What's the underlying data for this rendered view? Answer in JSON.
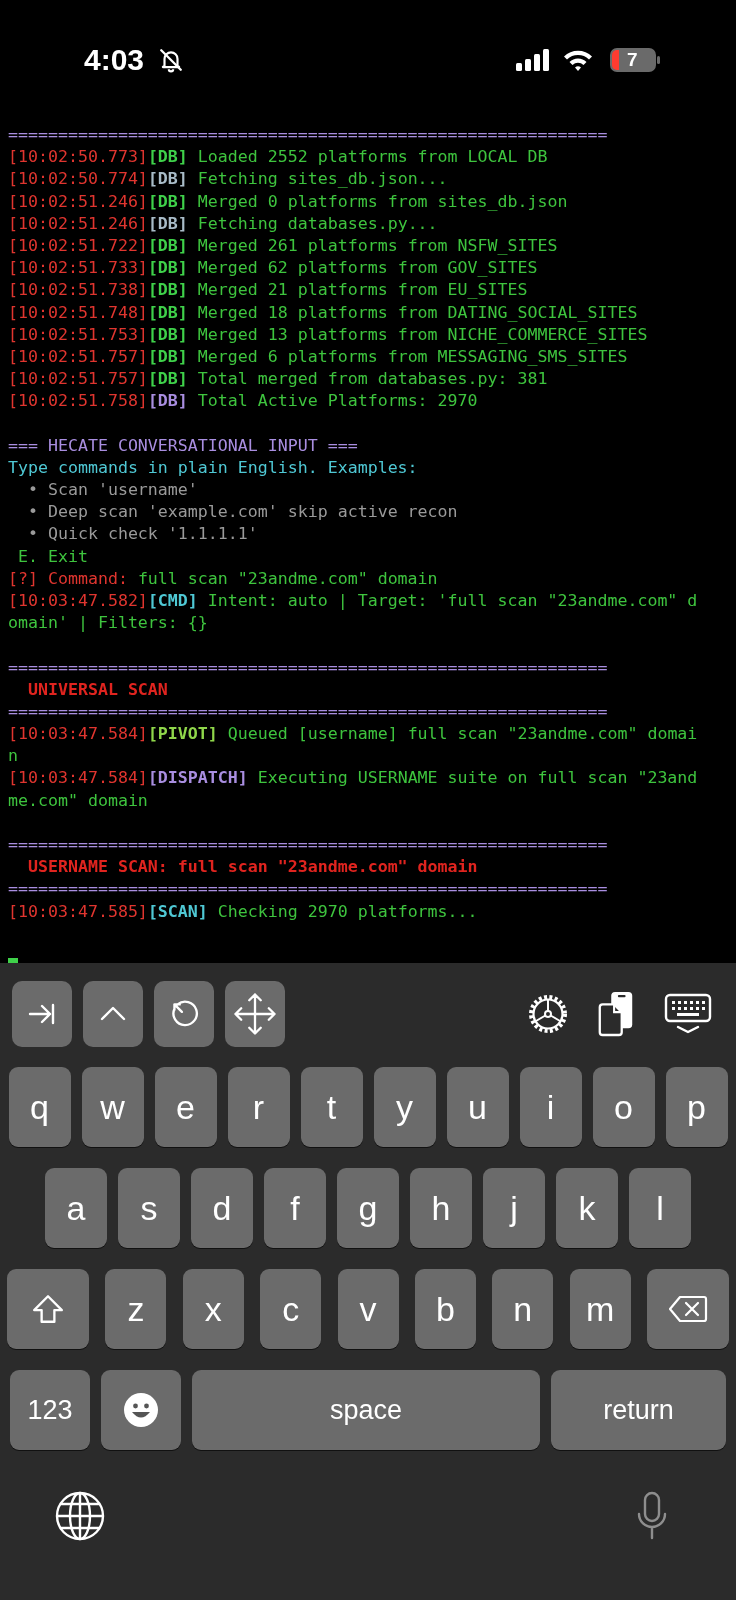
{
  "status_bar": {
    "time": "4:03",
    "battery": "7"
  },
  "terminal": {
    "lines": [
      {
        "kind": "text",
        "segments": [
          {
            "kind": "separator",
            "text": "============================================================",
            "color": "#a98ee0"
          }
        ]
      },
      {
        "kind": "text",
        "segments": [
          {
            "kind": "timestamp",
            "text": "[10:02:50.773]",
            "color": "#e0352f"
          },
          {
            "kind": "tag",
            "text": "[DB]",
            "color": "#3fd14a"
          },
          {
            "kind": "message",
            "text": " Loaded 2552 platforms from LOCAL DB",
            "color": "#3ec43e"
          }
        ]
      },
      {
        "kind": "text",
        "segments": [
          {
            "kind": "timestamp",
            "text": "[10:02:50.774]",
            "color": "#e0352f"
          },
          {
            "kind": "tag",
            "text": "[DB]",
            "color": "#a9bcc8"
          },
          {
            "kind": "message",
            "text": " Fetching sites_db.json...",
            "color": "#3ec43e"
          }
        ]
      },
      {
        "kind": "text",
        "segments": [
          {
            "kind": "timestamp",
            "text": "[10:02:51.246]",
            "color": "#e0352f"
          },
          {
            "kind": "tag",
            "text": "[DB]",
            "color": "#3fd14a"
          },
          {
            "kind": "message",
            "text": " Merged 0 platforms from sites_db.json",
            "color": "#3ec43e"
          }
        ]
      },
      {
        "kind": "text",
        "segments": [
          {
            "kind": "timestamp",
            "text": "[10:02:51.246]",
            "color": "#e0352f"
          },
          {
            "kind": "tag",
            "text": "[DB]",
            "color": "#a9bcc8"
          },
          {
            "kind": "message",
            "text": " Fetching databases.py...",
            "color": "#3ec43e"
          }
        ]
      },
      {
        "kind": "text",
        "segments": [
          {
            "kind": "timestamp",
            "text": "[10:02:51.722]",
            "color": "#e0352f"
          },
          {
            "kind": "tag",
            "text": "[DB]",
            "color": "#3fd14a"
          },
          {
            "kind": "message",
            "text": " Merged 261 platforms from NSFW_SITES",
            "color": "#3ec43e"
          }
        ]
      },
      {
        "kind": "text",
        "segments": [
          {
            "kind": "timestamp",
            "text": "[10:02:51.733]",
            "color": "#e0352f"
          },
          {
            "kind": "tag",
            "text": "[DB]",
            "color": "#3fd14a"
          },
          {
            "kind": "message",
            "text": " Merged 62 platforms from GOV_SITES",
            "color": "#3ec43e"
          }
        ]
      },
      {
        "kind": "text",
        "segments": [
          {
            "kind": "timestamp",
            "text": "[10:02:51.738]",
            "color": "#e0352f"
          },
          {
            "kind": "tag",
            "text": "[DB]",
            "color": "#3fd14a"
          },
          {
            "kind": "message",
            "text": " Merged 21 platforms from EU_SITES",
            "color": "#3ec43e"
          }
        ]
      },
      {
        "kind": "text",
        "segments": [
          {
            "kind": "timestamp",
            "text": "[10:02:51.748]",
            "color": "#e0352f"
          },
          {
            "kind": "tag",
            "text": "[DB]",
            "color": "#3fd14a"
          },
          {
            "kind": "message",
            "text": " Merged 18 platforms from DATING_SOCIAL_SITES",
            "color": "#3ec43e"
          }
        ]
      },
      {
        "kind": "text",
        "segments": [
          {
            "kind": "timestamp",
            "text": "[10:02:51.753]",
            "color": "#e0352f"
          },
          {
            "kind": "tag",
            "text": "[DB]",
            "color": "#3fd14a"
          },
          {
            "kind": "message",
            "text": " Merged 13 platforms from NICHE_COMMERCE_SITES",
            "color": "#3ec43e"
          }
        ]
      },
      {
        "kind": "text",
        "segments": [
          {
            "kind": "timestamp",
            "text": "[10:02:51.757]",
            "color": "#e0352f"
          },
          {
            "kind": "tag",
            "text": "[DB]",
            "color": "#3fd14a"
          },
          {
            "kind": "message",
            "text": " Merged 6 platforms from MESSAGING_SMS_SITES",
            "color": "#3ec43e"
          }
        ]
      },
      {
        "kind": "text",
        "segments": [
          {
            "kind": "timestamp",
            "text": "[10:02:51.757]",
            "color": "#e0352f"
          },
          {
            "kind": "tag",
            "text": "[DB]",
            "color": "#3fd14a"
          },
          {
            "kind": "message",
            "text": " Total merged from databases.py: 381",
            "color": "#3ec43e"
          }
        ]
      },
      {
        "kind": "text",
        "segments": [
          {
            "kind": "timestamp",
            "text": "[10:02:51.758]",
            "color": "#e0352f"
          },
          {
            "kind": "tag",
            "text": "[DB]",
            "color": "#a98ee0"
          },
          {
            "kind": "message",
            "text": " Total Active Platforms: 2970",
            "color": "#3ec43e"
          }
        ]
      },
      {
        "kind": "blank"
      },
      {
        "kind": "text",
        "segments": [
          {
            "kind": "heading",
            "text": "=== HECATE CONVERSATIONAL INPUT ===",
            "color": "#a98ee0"
          }
        ]
      },
      {
        "kind": "text",
        "segments": [
          {
            "kind": "message",
            "text": "Type commands in plain English. Examples:",
            "color": "#4fc8d4"
          }
        ]
      },
      {
        "kind": "text",
        "segments": [
          {
            "kind": "message",
            "text": "  • Scan 'username'",
            "color": "#9a9a9a"
          }
        ]
      },
      {
        "kind": "text",
        "segments": [
          {
            "kind": "message",
            "text": "  • Deep scan 'example.com' skip active recon",
            "color": "#9a9a9a"
          }
        ]
      },
      {
        "kind": "text",
        "segments": [
          {
            "kind": "message",
            "text": "  • Quick check '1.1.1.1'",
            "color": "#9a9a9a"
          }
        ]
      },
      {
        "kind": "text",
        "segments": [
          {
            "kind": "message",
            "text": " E. Exit",
            "color": "#3ec43e"
          }
        ]
      },
      {
        "kind": "text",
        "segments": [
          {
            "kind": "prompt",
            "text": "[?] Command: ",
            "color": "#e0352f"
          },
          {
            "kind": "message",
            "text": "full scan \"23andme.com\" domain",
            "color": "#3ec43e"
          }
        ]
      },
      {
        "kind": "text",
        "segments": [
          {
            "kind": "timestamp",
            "text": "[10:03:47.582]",
            "color": "#e0352f"
          },
          {
            "kind": "tag",
            "text": "[CMD]",
            "color": "#4fc8d4"
          },
          {
            "kind": "message",
            "text": " Intent: auto | Target: 'full scan \"23andme.com\" d",
            "color": "#3ec43e"
          }
        ]
      },
      {
        "kind": "text",
        "segments": [
          {
            "kind": "message",
            "text": "omain' | Filters: {}",
            "color": "#3ec43e"
          }
        ]
      },
      {
        "kind": "blank"
      },
      {
        "kind": "text",
        "segments": [
          {
            "kind": "separator",
            "text": "============================================================",
            "color": "#a98ee0"
          }
        ]
      },
      {
        "kind": "text",
        "segments": [
          {
            "kind": "title",
            "text": "  UNIVERSAL SCAN",
            "color": "#e0241f"
          }
        ]
      },
      {
        "kind": "text",
        "segments": [
          {
            "kind": "separator",
            "text": "============================================================",
            "color": "#a98ee0"
          }
        ]
      },
      {
        "kind": "text",
        "segments": [
          {
            "kind": "timestamp",
            "text": "[10:03:47.584]",
            "color": "#e0352f"
          },
          {
            "kind": "tag",
            "text": "[PIVOT]",
            "color": "#8fd64a"
          },
          {
            "kind": "message",
            "text": " Queued [username] full scan \"23andme.com\" domai",
            "color": "#3ec43e"
          }
        ]
      },
      {
        "kind": "text",
        "segments": [
          {
            "kind": "message",
            "text": "n",
            "color": "#3ec43e"
          }
        ]
      },
      {
        "kind": "text",
        "segments": [
          {
            "kind": "timestamp",
            "text": "[10:03:47.584]",
            "color": "#e0352f"
          },
          {
            "kind": "tag",
            "text": "[DISPATCH]",
            "color": "#a98ee0"
          },
          {
            "kind": "message",
            "text": " Executing USERNAME suite on full scan \"23and",
            "color": "#3ec43e"
          }
        ]
      },
      {
        "kind": "text",
        "segments": [
          {
            "kind": "message",
            "text": "me.com\" domain",
            "color": "#3ec43e"
          }
        ]
      },
      {
        "kind": "blank"
      },
      {
        "kind": "text",
        "segments": [
          {
            "kind": "separator",
            "text": "============================================================",
            "color": "#a98ee0"
          }
        ]
      },
      {
        "kind": "text",
        "segments": [
          {
            "kind": "title",
            "text": "  USERNAME SCAN: full scan \"23andme.com\" domain",
            "color": "#e0241f"
          }
        ]
      },
      {
        "kind": "text",
        "segments": [
          {
            "kind": "separator",
            "text": "============================================================",
            "color": "#a98ee0"
          }
        ]
      },
      {
        "kind": "text",
        "segments": [
          {
            "kind": "timestamp",
            "text": "[10:03:47.585]",
            "color": "#e0352f"
          },
          {
            "kind": "tag",
            "text": "[SCAN]",
            "color": "#4fc8d4"
          },
          {
            "kind": "message",
            "text": " Checking 2970 platforms...",
            "color": "#3ec43e"
          }
        ]
      },
      {
        "kind": "blank"
      },
      {
        "kind": "cursor"
      }
    ]
  },
  "keyboard": {
    "rows": [
      [
        {
          "kind": "char",
          "label": "q"
        },
        {
          "kind": "char",
          "label": "w"
        },
        {
          "kind": "char",
          "label": "e"
        },
        {
          "kind": "char",
          "label": "r"
        },
        {
          "kind": "char",
          "label": "t"
        },
        {
          "kind": "char",
          "label": "y"
        },
        {
          "kind": "char",
          "label": "u"
        },
        {
          "kind": "char",
          "label": "i"
        },
        {
          "kind": "char",
          "label": "o"
        },
        {
          "kind": "char",
          "label": "p"
        }
      ],
      [
        {
          "kind": "char",
          "label": "a"
        },
        {
          "kind": "char",
          "label": "s"
        },
        {
          "kind": "char",
          "label": "d"
        },
        {
          "kind": "char",
          "label": "f"
        },
        {
          "kind": "char",
          "label": "g"
        },
        {
          "kind": "char",
          "label": "h"
        },
        {
          "kind": "char",
          "label": "j"
        },
        {
          "kind": "char",
          "label": "k"
        },
        {
          "kind": "char",
          "label": "l"
        }
      ],
      [
        {
          "kind": "shift"
        },
        {
          "kind": "char",
          "label": "z"
        },
        {
          "kind": "char",
          "label": "x"
        },
        {
          "kind": "char",
          "label": "c"
        },
        {
          "kind": "char",
          "label": "v"
        },
        {
          "kind": "char",
          "label": "b"
        },
        {
          "kind": "char",
          "label": "n"
        },
        {
          "kind": "char",
          "label": "m"
        },
        {
          "kind": "backspace"
        }
      ]
    ],
    "bottom_keys": {
      "numbers": "123",
      "space": "space",
      "return": "return"
    }
  }
}
